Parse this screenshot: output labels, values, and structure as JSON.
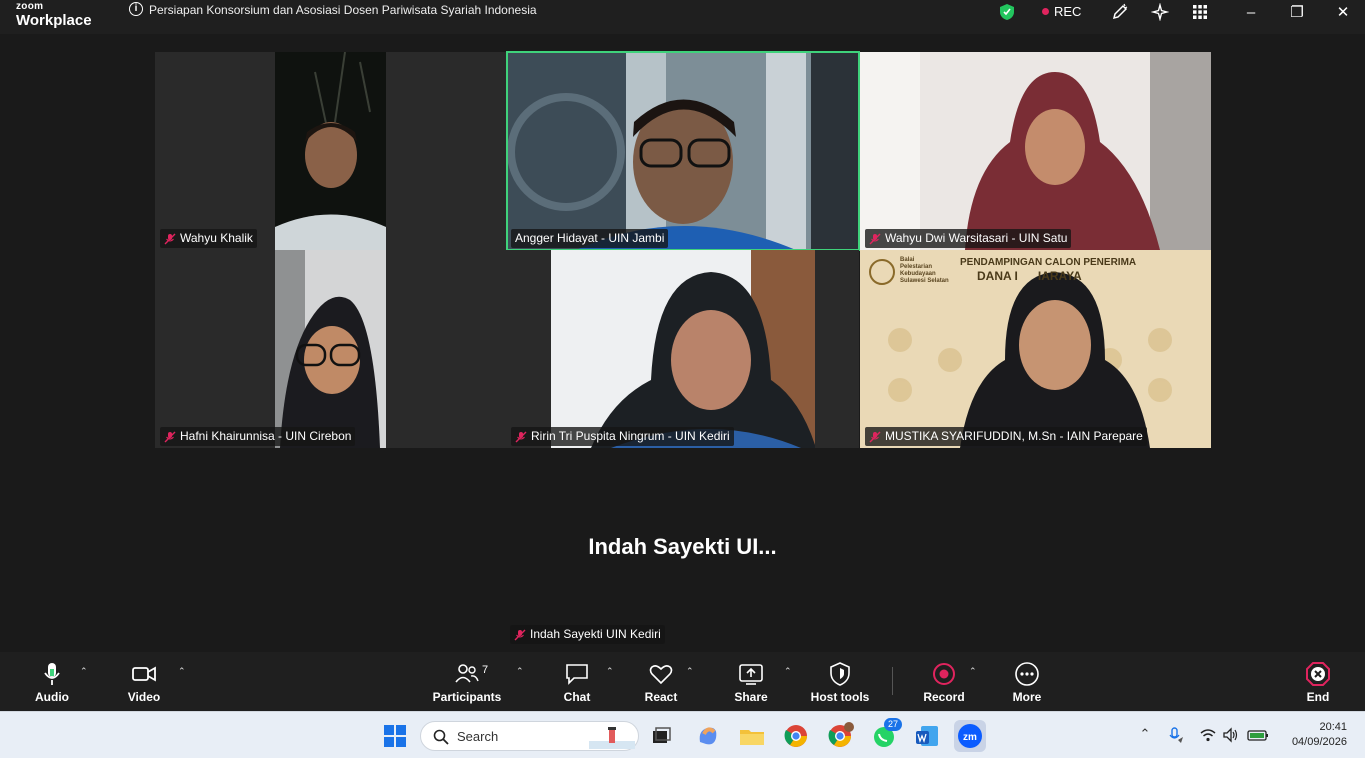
{
  "window": {
    "logo_top": "zoom",
    "logo_bottom": "Workplace",
    "meeting_title": "Persiapan Konsorsium dan Asosiasi Dosen Pariwisata Syariah Indonesia",
    "rec_label": "REC"
  },
  "participants_tiles": [
    {
      "name": "Wahyu Khalik",
      "muted": true
    },
    {
      "name": "Angger Hidayat - UIN Jambi",
      "muted": false,
      "active_speaker": true
    },
    {
      "name": "Wahyu Dwi Warsitasari - UIN Satu",
      "muted": true
    },
    {
      "name": "Hafni Khairunnisa - UIN Cirebon",
      "muted": true
    },
    {
      "name": "Ririn Tri Puspita Ningrum - UIN Kediri",
      "muted": true
    },
    {
      "name": "MUSTIKA SYARIFUDDIN, M.Sn - IAIN Parepare",
      "muted": true
    }
  ],
  "banner": {
    "org_line1": "Balai",
    "org_line2": "Pelestarian",
    "org_line3": "Kebudayaan",
    "org_line4": "Sulawesi Selatan",
    "headline1": "PENDAMPINGAN CALON PENERIMA",
    "headline2": "DANA I      IARAYA"
  },
  "no_video": {
    "display_name": "Indah Sayekti UI...",
    "label": "Indah Sayekti UIN Kediri"
  },
  "toolbar": {
    "audio": "Audio",
    "video": "Video",
    "participants": "Participants",
    "participants_count": "7",
    "chat": "Chat",
    "react": "React",
    "share": "Share",
    "host_tools": "Host tools",
    "record": "Record",
    "more": "More",
    "end": "End"
  },
  "taskbar": {
    "search_placeholder": "Search",
    "whatsapp_badge": "27",
    "time": "20:41",
    "date": "04/09/2026"
  },
  "colors": {
    "speaker_border": "#3fd27b",
    "rec_dot": "#e0245e",
    "end_red": "#e0245e",
    "shield_green": "#22c55e"
  }
}
